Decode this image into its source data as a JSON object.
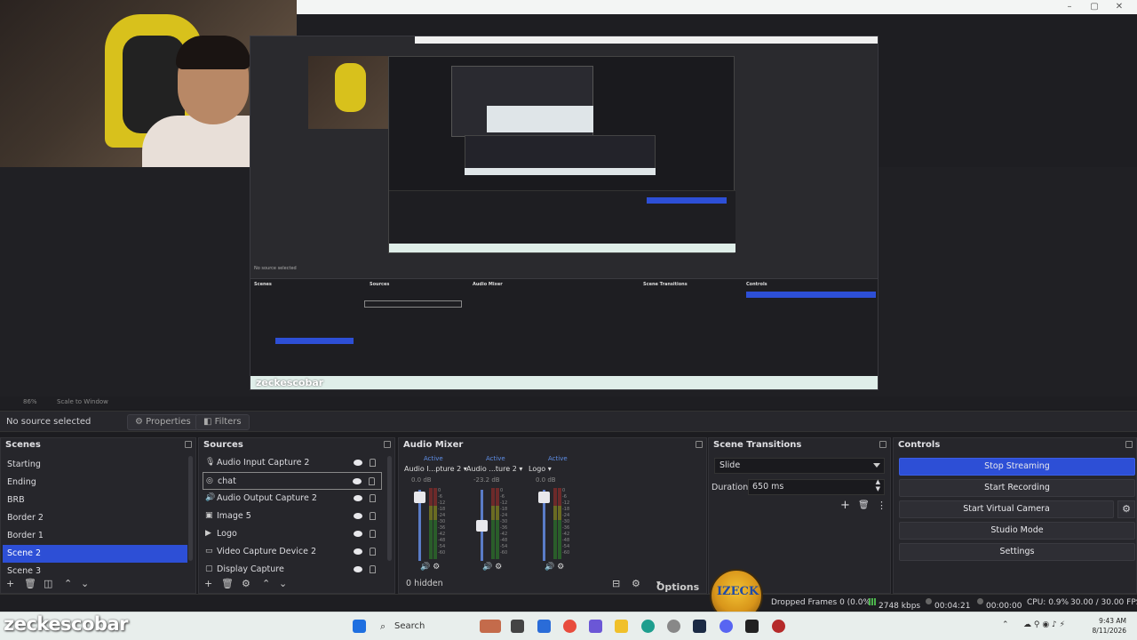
{
  "preview": {
    "watermark_inner": "zeckescobar",
    "scale_label": "Scale to Window",
    "inner_no_source": "No source selected"
  },
  "toolbar": {
    "no_source": "No source selected",
    "properties": "Properties",
    "filters": "Filters"
  },
  "scenes": {
    "title": "Scenes",
    "items": [
      "Starting",
      "Ending",
      "BRB",
      "Border 2",
      "Border 1",
      "Scene 2",
      "Scene 3"
    ],
    "selected_index": 5
  },
  "sources": {
    "title": "Sources",
    "items": [
      {
        "label": "Audio Input Capture 2",
        "icon": "microphone-icon"
      },
      {
        "label": "chat",
        "icon": "browser-icon"
      },
      {
        "label": "Audio Output Capture 2",
        "icon": "speaker-icon"
      },
      {
        "label": "Image 5",
        "icon": "image-icon"
      },
      {
        "label": "Logo",
        "icon": "media-icon"
      },
      {
        "label": "Video Capture Device 2",
        "icon": "camera-icon"
      },
      {
        "label": "Display Capture",
        "icon": "display-icon"
      }
    ]
  },
  "audio_mixer": {
    "title": "Audio Mixer",
    "channels": [
      {
        "name": "Audio I...pture 2",
        "status": "Active",
        "db": "0.0 dB"
      },
      {
        "name": "Audio ...ture 2",
        "status": "Active",
        "db": "-23.2 dB"
      },
      {
        "name": "Logo",
        "status": "Active",
        "db": "0.0 dB"
      }
    ],
    "hidden": "0 hidden",
    "options": "Options"
  },
  "transitions": {
    "title": "Scene Transitions",
    "selected": "Slide",
    "duration_label": "Duration",
    "duration_value": "650 ms"
  },
  "controls": {
    "title": "Controls",
    "stop_streaming": "Stop Streaming",
    "start_recording": "Start Recording",
    "start_virtual_camera": "Start Virtual Camera",
    "studio_mode": "Studio Mode",
    "settings": "Settings"
  },
  "status": {
    "dropped_frames": "Dropped Frames 0 (0.0%)",
    "bitrate": "2748 kbps",
    "stream_time": "00:04:21",
    "record_time": "00:00:00",
    "cpu": "CPU: 0.9%",
    "fps": "30.00 / 30.00 FPS"
  },
  "taskbar": {
    "watermark": "zeckescobar",
    "search": "Search",
    "time": "9:43 AM",
    "date": "8/11/2026"
  },
  "colors": {
    "accent": "#2d4fd6",
    "panel": "#26262b",
    "meter_green": "#2a5d2a",
    "meter_yellow": "#6a6b22",
    "meter_red": "#6d2a2a"
  }
}
